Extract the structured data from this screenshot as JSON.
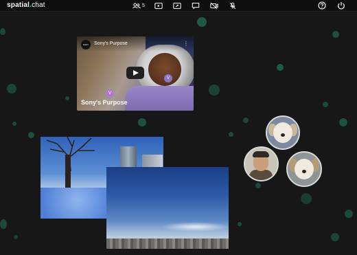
{
  "app": {
    "name_main": "spatial",
    "name_dot": ".",
    "name_suffix": "chat"
  },
  "toolbar": {
    "participants_count": "5",
    "icons": [
      "users-icon",
      "youtube-play-icon",
      "screen-share-icon",
      "present-icon",
      "camera-off-icon",
      "mic-off-icon"
    ]
  },
  "right_icons": [
    "help-icon",
    "power-icon"
  ],
  "video_tile": {
    "channel_badge": "SONY",
    "title": "Sony's Purpose",
    "overlay_title": "Sony's Purpose",
    "cursor_labels": [
      "V",
      "V"
    ]
  },
  "colors": {
    "background": "#171717",
    "accent": "#28d7a8",
    "bubble": "#1f6b55",
    "cursor": "#b07ad4"
  },
  "participants": [
    "sony-dog-1",
    "man-with-glasses",
    "sony-dog-2"
  ]
}
